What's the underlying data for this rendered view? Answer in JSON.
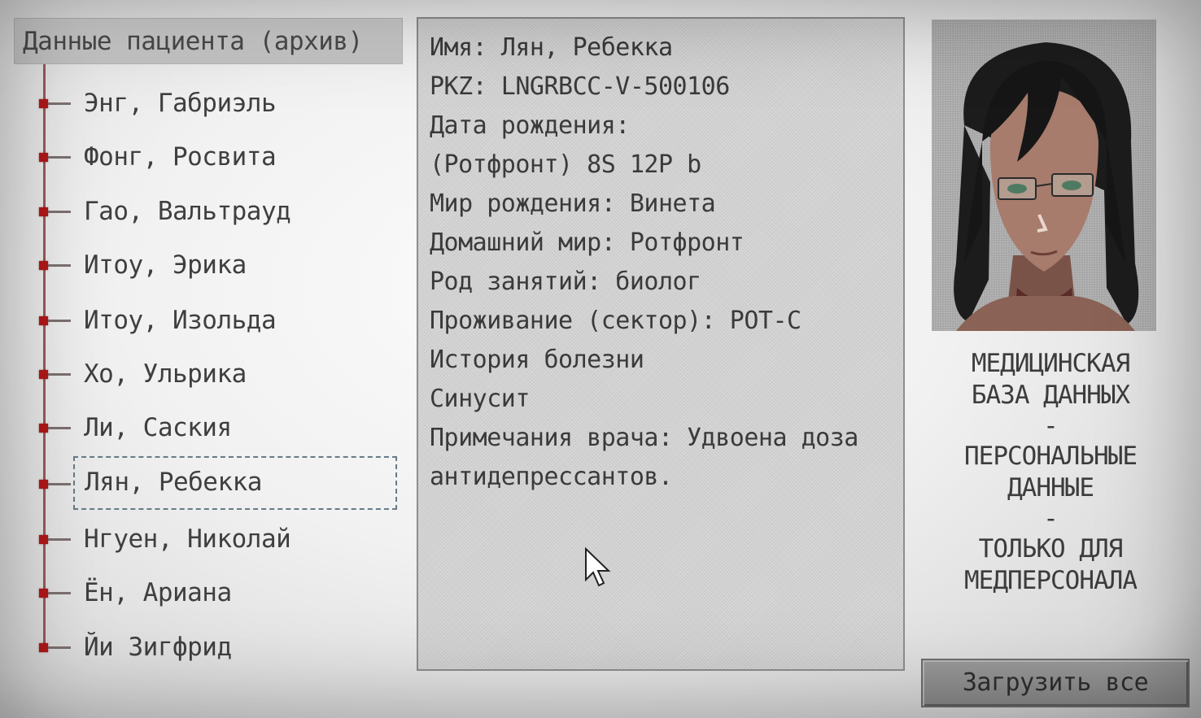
{
  "tree": {
    "header": "Данные пациента (архив)",
    "items": [
      {
        "label": "Энг, Габриэль"
      },
      {
        "label": "Фонг, Росвита"
      },
      {
        "label": "Гао, Вальтрауд"
      },
      {
        "label": "Итоу, Эрика"
      },
      {
        "label": "Итоу, Изольда"
      },
      {
        "label": "Хо, Ульрика"
      },
      {
        "label": "Ли, Саския"
      },
      {
        "label": "Лян, Ребекка"
      },
      {
        "label": "Нгуен, Николай"
      },
      {
        "label": "Ён, Ариана"
      },
      {
        "label": "Йи Зигфрид"
      }
    ],
    "selected_index": 7
  },
  "details": {
    "lines": [
      "Имя: Лян, Ребекка",
      "PKZ: LNGRBCC-V-500106",
      "Дата рождения:",
      "(Ротфронт) 8S 12P b",
      "Мир рождения: Винета",
      "Домашний мир: Ротфронт",
      "Род занятий: биолог",
      "Проживание (сектор): POT-C",
      "История болезни",
      "Синусит",
      "Примечания врача: Удвоена доза антидепрессантов."
    ]
  },
  "notice": {
    "line1": "МЕДИЦИНСКАЯ",
    "line2": "БАЗА ДАННЫХ",
    "sep1": "-",
    "line3": "ПЕРСОНАЛЬНЫЕ",
    "line4": "ДАННЫЕ",
    "sep2": "-",
    "line5": "ТОЛЬКО ДЛЯ",
    "line6": "МЕДПЕРСОНАЛА"
  },
  "buttons": {
    "load_all": "Загрузить все"
  },
  "colors": {
    "tree_node": "#b01818",
    "selection_outline": "#677b86"
  }
}
